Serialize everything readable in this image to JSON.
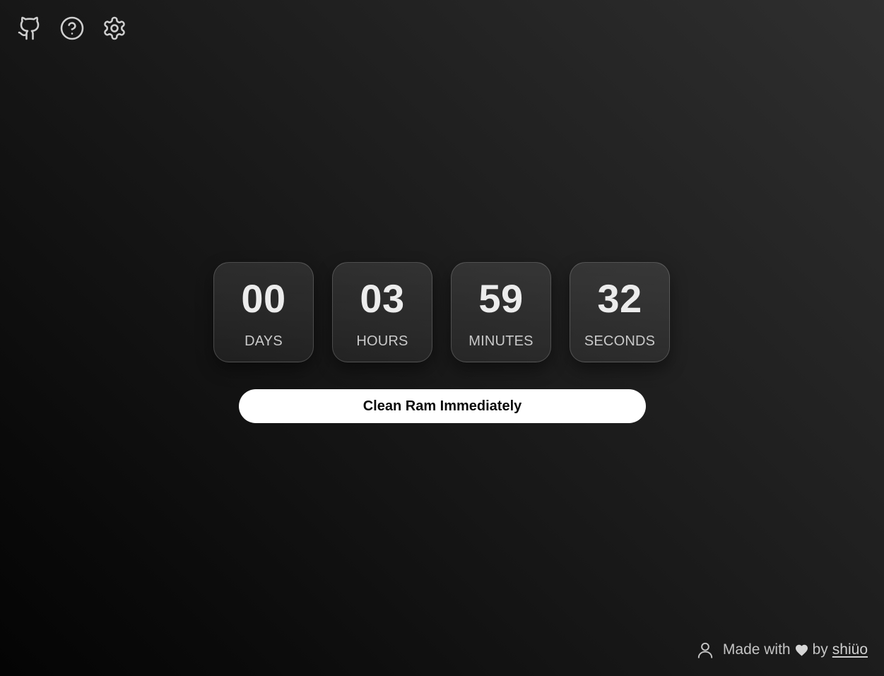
{
  "toolbar": {
    "icons": [
      "github-icon",
      "help-circle-icon",
      "gear-icon"
    ]
  },
  "countdown": {
    "units": [
      {
        "value": "00",
        "label": "DAYS"
      },
      {
        "value": "03",
        "label": "HOURS"
      },
      {
        "value": "59",
        "label": "MINUTES"
      },
      {
        "value": "32",
        "label": "SECONDS"
      }
    ]
  },
  "action": {
    "label": "Clean Ram Immediately"
  },
  "footer": {
    "made_with": "Made with",
    "by": "by",
    "author": "shiüo",
    "icons": [
      "user-icon",
      "heart-icon"
    ]
  },
  "colors": {
    "background_light": "#2f2f2f",
    "background_dark": "#040404",
    "button_bg": "#ffffff",
    "button_text": "#0a0a0a",
    "text": "#e6e6e6"
  }
}
